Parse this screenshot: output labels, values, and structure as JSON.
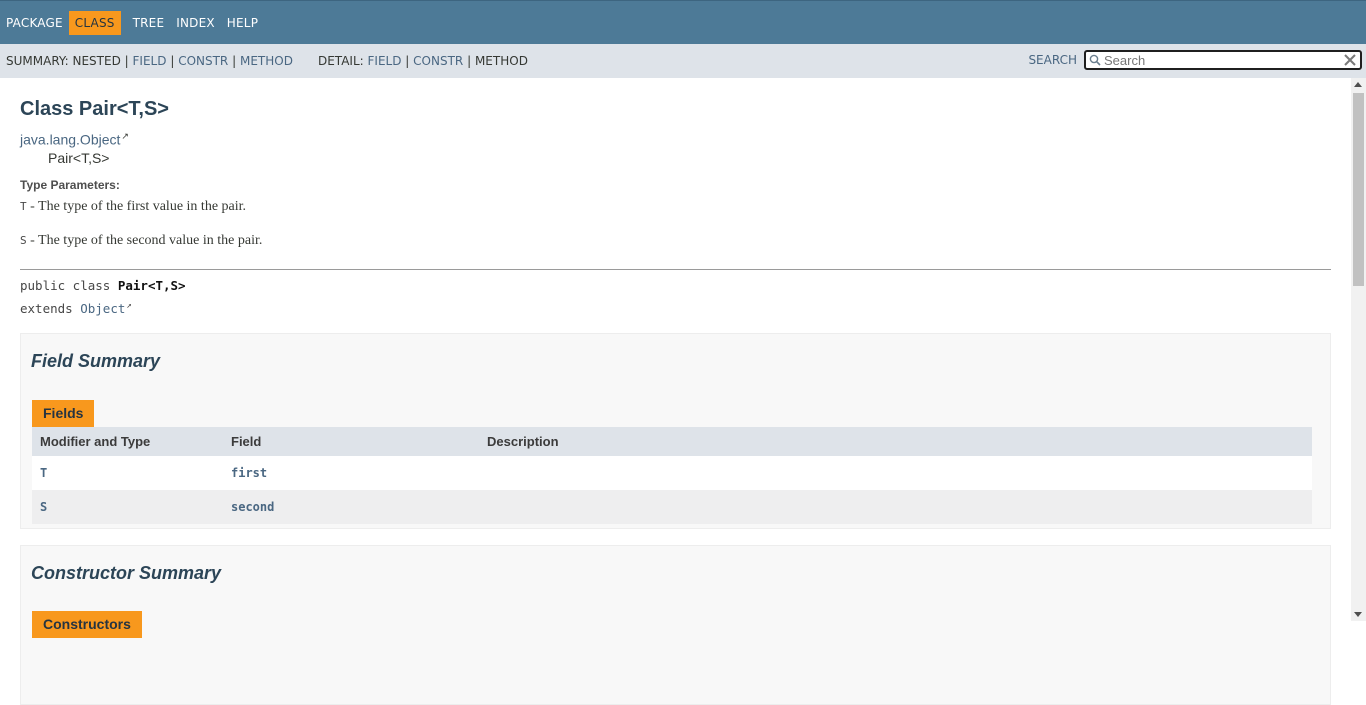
{
  "nav": {
    "items": [
      {
        "label": "Package"
      },
      {
        "label": "Class"
      },
      {
        "label": "Tree"
      },
      {
        "label": "Index"
      },
      {
        "label": "Help"
      }
    ],
    "active": "Class"
  },
  "subnav": {
    "summary_label": "SUMMARY:",
    "summary_nested": "NESTED",
    "summary_field": "FIELD",
    "summary_constr": "CONSTR",
    "summary_method": "METHOD",
    "detail_label": "DETAIL:",
    "detail_field": "FIELD",
    "detail_constr": "CONSTR",
    "detail_method": "METHOD",
    "sep": "|",
    "search_label": "SEARCH",
    "search_placeholder": "Search",
    "search_value": ""
  },
  "header": {
    "title": "Class Pair<T,S>",
    "inherit_parent": "java.lang.Object",
    "inherit_child": "Pair<T,S>"
  },
  "type_params": {
    "heading": "Type Parameters:",
    "items": [
      {
        "name": "T",
        "desc": " - The type of the first value in the pair."
      },
      {
        "name": "S",
        "desc": " - The type of the second value in the pair."
      }
    ]
  },
  "signature": {
    "line1_prefix": "public class ",
    "line1_name": "Pair<T,S>",
    "line2_prefix": "extends ",
    "line2_link": "Object"
  },
  "field_summary": {
    "title": "Field Summary",
    "caption": "Fields",
    "columns": [
      "Modifier and Type",
      "Field",
      "Description"
    ],
    "rows": [
      {
        "type": "T",
        "field": "first",
        "desc": ""
      },
      {
        "type": "S",
        "field": "second",
        "desc": ""
      }
    ]
  },
  "constructor_summary": {
    "title": "Constructor Summary",
    "caption": "Constructors"
  },
  "colors": {
    "nav_bg": "#4d7a97",
    "subnav_bg": "#dee3e9",
    "accent_orange": "#f8981d",
    "link": "#4a6782",
    "title": "#2c4557"
  }
}
